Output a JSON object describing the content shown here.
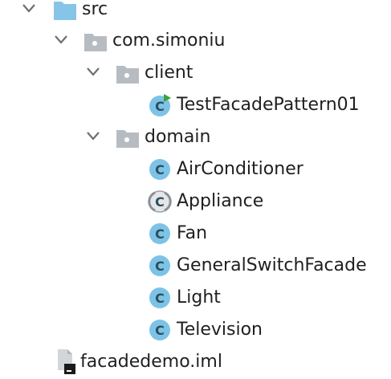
{
  "tree": {
    "src": {
      "label": "src",
      "icon": "source-folder-icon",
      "expanded": true
    },
    "package": {
      "label": "com.simoniu",
      "icon": "package-folder-icon",
      "expanded": true
    },
    "client": {
      "label": "client",
      "icon": "package-folder-icon",
      "expanded": true
    },
    "test_class": {
      "label": "TestFacadePattern01",
      "icon": "runnable-class-icon"
    },
    "domain": {
      "label": "domain",
      "icon": "package-folder-icon",
      "expanded": true
    },
    "domain_items": [
      {
        "label": "AirConditioner",
        "icon": "class-icon"
      },
      {
        "label": "Appliance",
        "icon": "abstract-class-icon"
      },
      {
        "label": "Fan",
        "icon": "class-icon"
      },
      {
        "label": "GeneralSwitchFacade",
        "icon": "class-icon"
      },
      {
        "label": "Light",
        "icon": "class-icon"
      },
      {
        "label": "Television",
        "icon": "class-icon"
      }
    ],
    "module_file": {
      "label": "facadedemo.iml",
      "icon": "iml-file-icon"
    }
  },
  "colors": {
    "chevron": "#6e6e6e",
    "folder_blue": "#87c5e8",
    "folder_grey": "#b7bcc2",
    "class_circle": "#7cc3e6",
    "class_letter": "#2d4d60",
    "run_arrow": "#3aa23a",
    "text": "#1f1f1f"
  }
}
